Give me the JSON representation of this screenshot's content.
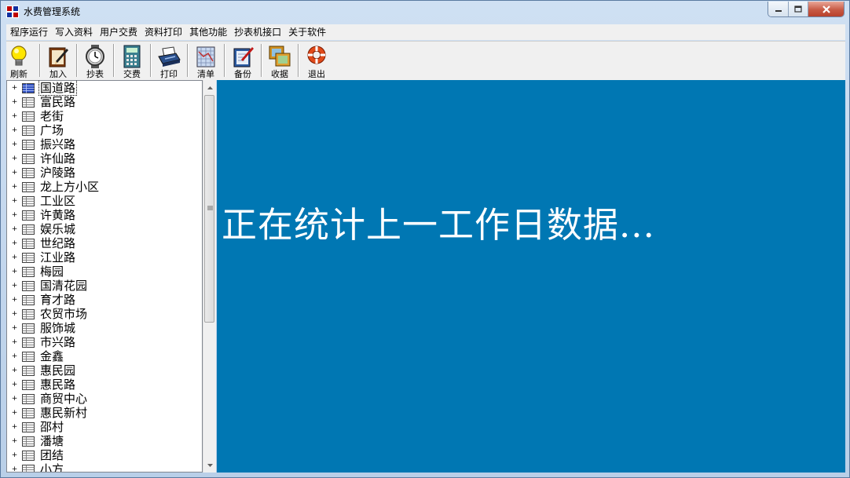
{
  "window": {
    "title": "水费管理系统"
  },
  "menu": [
    "程序运行",
    "写入资料",
    "用户交费",
    "资料打印",
    "其他功能",
    "抄表机接口",
    "关于软件"
  ],
  "toolbar": {
    "refresh": "刷新",
    "add": "加入",
    "meter": "抄表",
    "pay": "交费",
    "print": "打印",
    "list": "清单",
    "backup": "备份",
    "receipt": "收据",
    "exit": "退出"
  },
  "tree": {
    "items": [
      "国道路",
      "富民路",
      "老街",
      "广场",
      "振兴路",
      "许仙路",
      "沪陵路",
      "龙上方小区",
      "工业区",
      "许黄路",
      "娱乐城",
      "世纪路",
      "江业路",
      "梅园",
      "国清花园",
      "育才路",
      "农贸市场",
      "服饰城",
      "市兴路",
      "金鑫",
      "惠民园",
      "惠民路",
      "商贸中心",
      "惠民新村",
      "邵村",
      "潘塘",
      "团结",
      "小方"
    ],
    "selected_index": 0,
    "expander_symbol": "+"
  },
  "main": {
    "status_message": "正在统计上一工作日数据..."
  },
  "colors": {
    "main_bg": "#0077b3",
    "tree_bg": "#ffffff",
    "toolbar_bg": "#f0f0f0"
  }
}
